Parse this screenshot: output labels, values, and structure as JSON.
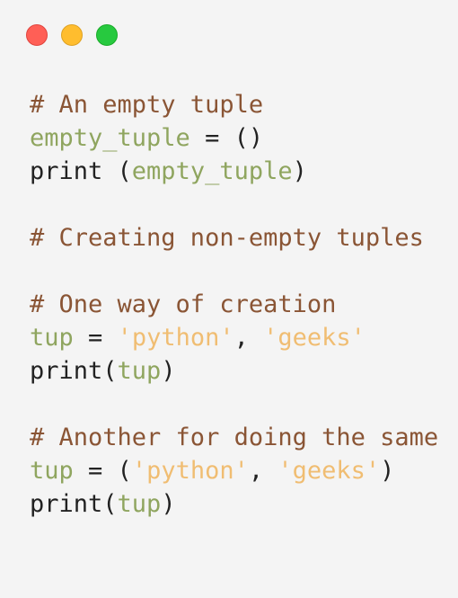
{
  "window": {
    "controls": {
      "close_color": "#ff5f56",
      "minimize_color": "#ffbd2e",
      "maximize_color": "#27c93f"
    }
  },
  "colors": {
    "comment": "#8a5535",
    "identifier": "#8fa55f",
    "string": "#f0bd72",
    "text": "#222222",
    "background": "#f4f4f4"
  },
  "code": {
    "lines": [
      {
        "tokens": [
          {
            "t": "# An empty tuple",
            "k": "comment"
          }
        ]
      },
      {
        "tokens": [
          {
            "t": "empty_tuple",
            "k": "ident"
          },
          {
            "t": " = ()",
            "k": "plain"
          }
        ]
      },
      {
        "tokens": [
          {
            "t": "print (",
            "k": "plain"
          },
          {
            "t": "empty_tuple",
            "k": "ident"
          },
          {
            "t": ")",
            "k": "plain"
          }
        ]
      },
      {
        "tokens": []
      },
      {
        "tokens": [
          {
            "t": "# Creating non-empty tuples",
            "k": "comment"
          }
        ]
      },
      {
        "tokens": []
      },
      {
        "tokens": [
          {
            "t": "# One way of creation",
            "k": "comment"
          }
        ]
      },
      {
        "tokens": [
          {
            "t": "tup",
            "k": "ident"
          },
          {
            "t": " = ",
            "k": "plain"
          },
          {
            "t": "'python'",
            "k": "str"
          },
          {
            "t": ", ",
            "k": "plain"
          },
          {
            "t": "'geeks'",
            "k": "str"
          }
        ]
      },
      {
        "tokens": [
          {
            "t": "print(",
            "k": "plain"
          },
          {
            "t": "tup",
            "k": "ident"
          },
          {
            "t": ")",
            "k": "plain"
          }
        ]
      },
      {
        "tokens": []
      },
      {
        "tokens": [
          {
            "t": "# Another for doing the same",
            "k": "comment"
          }
        ]
      },
      {
        "tokens": [
          {
            "t": "tup",
            "k": "ident"
          },
          {
            "t": " = (",
            "k": "plain"
          },
          {
            "t": "'python'",
            "k": "str"
          },
          {
            "t": ", ",
            "k": "plain"
          },
          {
            "t": "'geeks'",
            "k": "str"
          },
          {
            "t": ")",
            "k": "plain"
          }
        ]
      },
      {
        "tokens": [
          {
            "t": "print(",
            "k": "plain"
          },
          {
            "t": "tup",
            "k": "ident"
          },
          {
            "t": ")",
            "k": "plain"
          }
        ]
      }
    ]
  }
}
